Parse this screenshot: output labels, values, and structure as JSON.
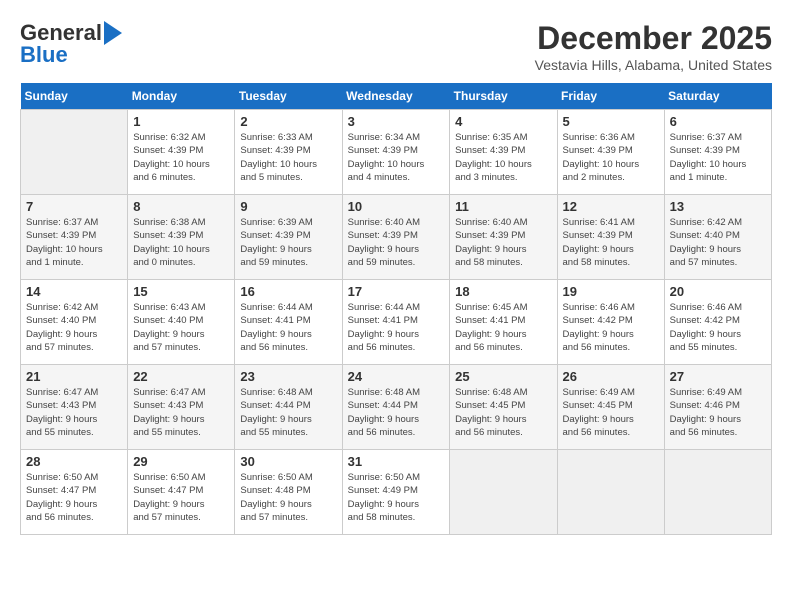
{
  "logo": {
    "line1": "General",
    "line2": "Blue"
  },
  "title": "December 2025",
  "subtitle": "Vestavia Hills, Alabama, United States",
  "days_of_week": [
    "Sunday",
    "Monday",
    "Tuesday",
    "Wednesday",
    "Thursday",
    "Friday",
    "Saturday"
  ],
  "weeks": [
    [
      {
        "day": "",
        "info": ""
      },
      {
        "day": "1",
        "info": "Sunrise: 6:32 AM\nSunset: 4:39 PM\nDaylight: 10 hours\nand 6 minutes."
      },
      {
        "day": "2",
        "info": "Sunrise: 6:33 AM\nSunset: 4:39 PM\nDaylight: 10 hours\nand 5 minutes."
      },
      {
        "day": "3",
        "info": "Sunrise: 6:34 AM\nSunset: 4:39 PM\nDaylight: 10 hours\nand 4 minutes."
      },
      {
        "day": "4",
        "info": "Sunrise: 6:35 AM\nSunset: 4:39 PM\nDaylight: 10 hours\nand 3 minutes."
      },
      {
        "day": "5",
        "info": "Sunrise: 6:36 AM\nSunset: 4:39 PM\nDaylight: 10 hours\nand 2 minutes."
      },
      {
        "day": "6",
        "info": "Sunrise: 6:37 AM\nSunset: 4:39 PM\nDaylight: 10 hours\nand 1 minute."
      }
    ],
    [
      {
        "day": "7",
        "info": "Sunrise: 6:37 AM\nSunset: 4:39 PM\nDaylight: 10 hours\nand 1 minute."
      },
      {
        "day": "8",
        "info": "Sunrise: 6:38 AM\nSunset: 4:39 PM\nDaylight: 10 hours\nand 0 minutes."
      },
      {
        "day": "9",
        "info": "Sunrise: 6:39 AM\nSunset: 4:39 PM\nDaylight: 9 hours\nand 59 minutes."
      },
      {
        "day": "10",
        "info": "Sunrise: 6:40 AM\nSunset: 4:39 PM\nDaylight: 9 hours\nand 59 minutes."
      },
      {
        "day": "11",
        "info": "Sunrise: 6:40 AM\nSunset: 4:39 PM\nDaylight: 9 hours\nand 58 minutes."
      },
      {
        "day": "12",
        "info": "Sunrise: 6:41 AM\nSunset: 4:39 PM\nDaylight: 9 hours\nand 58 minutes."
      },
      {
        "day": "13",
        "info": "Sunrise: 6:42 AM\nSunset: 4:40 PM\nDaylight: 9 hours\nand 57 minutes."
      }
    ],
    [
      {
        "day": "14",
        "info": "Sunrise: 6:42 AM\nSunset: 4:40 PM\nDaylight: 9 hours\nand 57 minutes."
      },
      {
        "day": "15",
        "info": "Sunrise: 6:43 AM\nSunset: 4:40 PM\nDaylight: 9 hours\nand 57 minutes."
      },
      {
        "day": "16",
        "info": "Sunrise: 6:44 AM\nSunset: 4:41 PM\nDaylight: 9 hours\nand 56 minutes."
      },
      {
        "day": "17",
        "info": "Sunrise: 6:44 AM\nSunset: 4:41 PM\nDaylight: 9 hours\nand 56 minutes."
      },
      {
        "day": "18",
        "info": "Sunrise: 6:45 AM\nSunset: 4:41 PM\nDaylight: 9 hours\nand 56 minutes."
      },
      {
        "day": "19",
        "info": "Sunrise: 6:46 AM\nSunset: 4:42 PM\nDaylight: 9 hours\nand 56 minutes."
      },
      {
        "day": "20",
        "info": "Sunrise: 6:46 AM\nSunset: 4:42 PM\nDaylight: 9 hours\nand 55 minutes."
      }
    ],
    [
      {
        "day": "21",
        "info": "Sunrise: 6:47 AM\nSunset: 4:43 PM\nDaylight: 9 hours\nand 55 minutes."
      },
      {
        "day": "22",
        "info": "Sunrise: 6:47 AM\nSunset: 4:43 PM\nDaylight: 9 hours\nand 55 minutes."
      },
      {
        "day": "23",
        "info": "Sunrise: 6:48 AM\nSunset: 4:44 PM\nDaylight: 9 hours\nand 55 minutes."
      },
      {
        "day": "24",
        "info": "Sunrise: 6:48 AM\nSunset: 4:44 PM\nDaylight: 9 hours\nand 56 minutes."
      },
      {
        "day": "25",
        "info": "Sunrise: 6:48 AM\nSunset: 4:45 PM\nDaylight: 9 hours\nand 56 minutes."
      },
      {
        "day": "26",
        "info": "Sunrise: 6:49 AM\nSunset: 4:45 PM\nDaylight: 9 hours\nand 56 minutes."
      },
      {
        "day": "27",
        "info": "Sunrise: 6:49 AM\nSunset: 4:46 PM\nDaylight: 9 hours\nand 56 minutes."
      }
    ],
    [
      {
        "day": "28",
        "info": "Sunrise: 6:50 AM\nSunset: 4:47 PM\nDaylight: 9 hours\nand 56 minutes."
      },
      {
        "day": "29",
        "info": "Sunrise: 6:50 AM\nSunset: 4:47 PM\nDaylight: 9 hours\nand 57 minutes."
      },
      {
        "day": "30",
        "info": "Sunrise: 6:50 AM\nSunset: 4:48 PM\nDaylight: 9 hours\nand 57 minutes."
      },
      {
        "day": "31",
        "info": "Sunrise: 6:50 AM\nSunset: 4:49 PM\nDaylight: 9 hours\nand 58 minutes."
      },
      {
        "day": "",
        "info": ""
      },
      {
        "day": "",
        "info": ""
      },
      {
        "day": "",
        "info": ""
      }
    ]
  ]
}
